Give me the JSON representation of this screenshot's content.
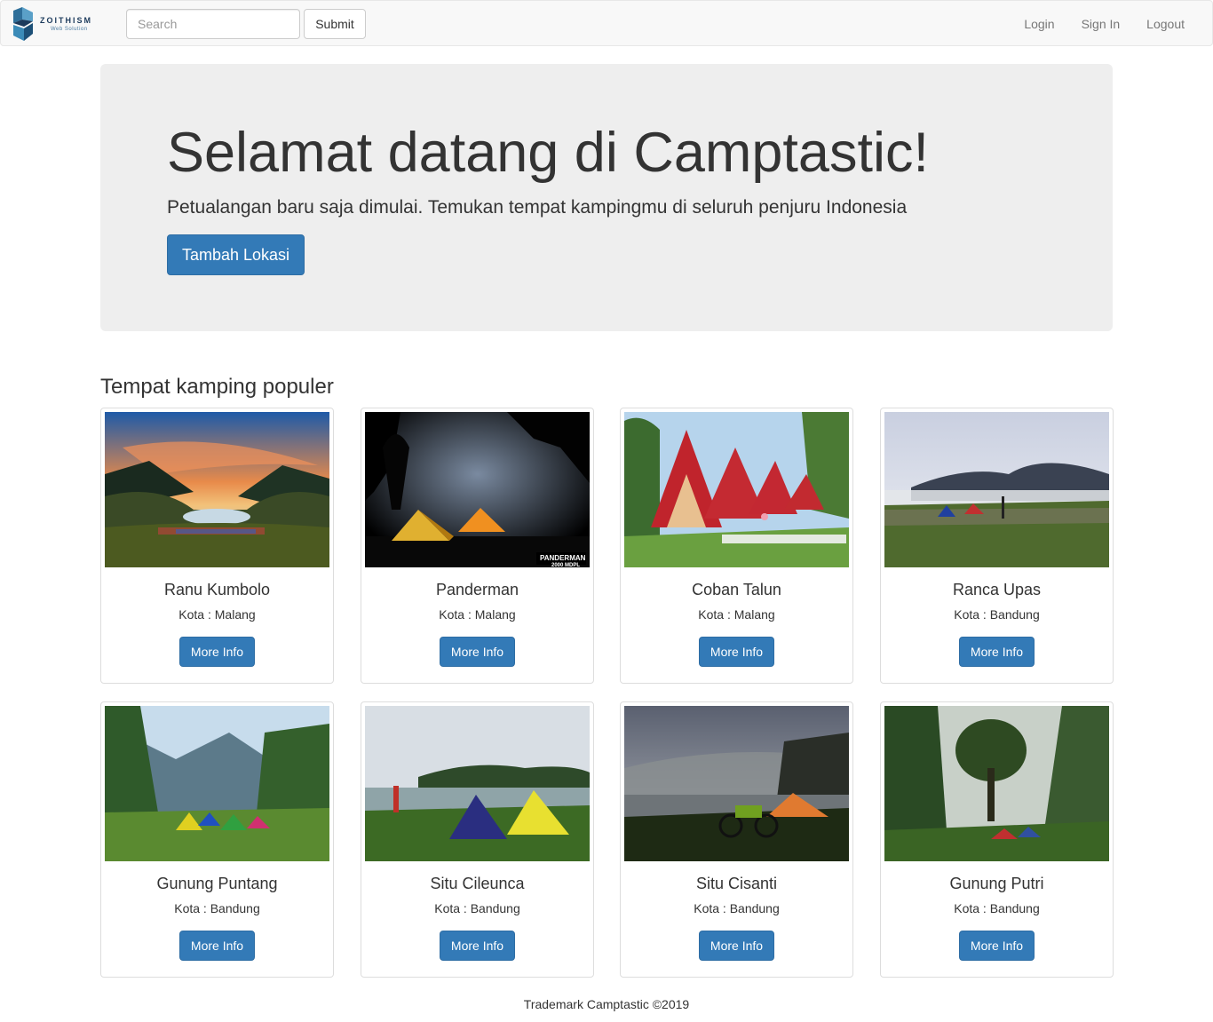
{
  "navbar": {
    "brand_name": "ZOITHISM",
    "brand_tagline": "Web Solution",
    "search_placeholder": "Search",
    "submit_label": "Submit",
    "links": [
      "Login",
      "Sign In",
      "Logout"
    ]
  },
  "hero": {
    "title": "Selamat datang di Camptastic!",
    "subtitle": "Petualangan baru saja dimulai. Temukan tempat kampingmu di seluruh penjuru Indonesia",
    "button_label": "Tambah Lokasi"
  },
  "section": {
    "title": "Tempat kamping populer"
  },
  "places": [
    {
      "name": "Ranu Kumbolo",
      "city": "Kota : Malang",
      "button": "More Info",
      "photo_text": ""
    },
    {
      "name": "Panderman",
      "city": "Kota : Malang",
      "button": "More Info",
      "photo_text": "PANDERMAN 2000 MDPL"
    },
    {
      "name": "Coban Talun",
      "city": "Kota : Malang",
      "button": "More Info",
      "photo_text": ""
    },
    {
      "name": "Ranca Upas",
      "city": "Kota : Bandung",
      "button": "More Info",
      "photo_text": ""
    },
    {
      "name": "Gunung Puntang",
      "city": "Kota : Bandung",
      "button": "More Info",
      "photo_text": ""
    },
    {
      "name": "Situ Cileunca",
      "city": "Kota : Bandung",
      "button": "More Info",
      "photo_text": ""
    },
    {
      "name": "Situ Cisanti",
      "city": "Kota : Bandung",
      "button": "More Info",
      "photo_text": ""
    },
    {
      "name": "Gunung Putri",
      "city": "Kota : Bandung",
      "button": "More Info",
      "photo_text": ""
    }
  ],
  "footer": {
    "text": "Trademark Camptastic ©2019"
  },
  "colors": {
    "primary": "#337ab7",
    "jumbotron_bg": "#eeeeee",
    "navbar_bg": "#f8f8f8"
  }
}
